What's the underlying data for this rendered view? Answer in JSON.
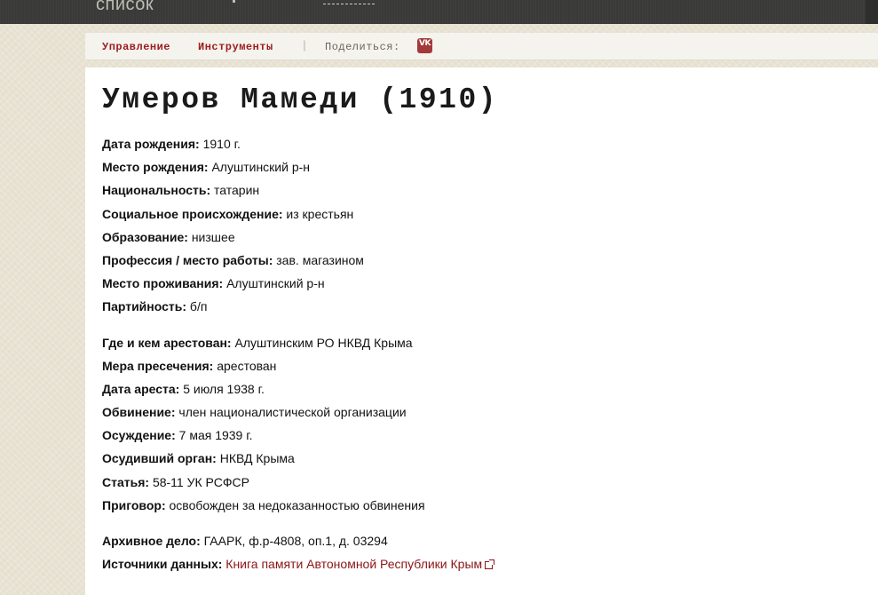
{
  "header": {
    "site_name": "список"
  },
  "toolbar": {
    "manage_label": "Управление",
    "tools_label": "Инструменты",
    "separator": "|",
    "share_label": "Поделиться:",
    "vk_text": "VK"
  },
  "person": {
    "title": "Умеров Мамеди (1910)",
    "group1": [
      {
        "label": "Дата рождения:",
        "value": "1910 г."
      },
      {
        "label": "Место рождения:",
        "value": "Алуштинский р-н"
      },
      {
        "label": "Национальность:",
        "value": "татарин"
      },
      {
        "label": "Социальное происхождение:",
        "value": "из крестьян"
      },
      {
        "label": "Образование:",
        "value": "низшее"
      },
      {
        "label": "Профессия / место работы:",
        "value": "зав. магазином"
      },
      {
        "label": "Место проживания:",
        "value": "Алуштинский р-н"
      },
      {
        "label": "Партийность:",
        "value": "б/п"
      }
    ],
    "group2": [
      {
        "label": "Где и кем арестован:",
        "value": "Алуштинским РО НКВД Крыма"
      },
      {
        "label": "Мера пресечения:",
        "value": "арестован"
      },
      {
        "label": "Дата ареста:",
        "value": "5 июля 1938 г."
      },
      {
        "label": "Обвинение:",
        "value": "член националистической организации"
      },
      {
        "label": "Осуждение:",
        "value": "7 мая 1939 г."
      },
      {
        "label": "Осудивший орган:",
        "value": "НКВД Крыма"
      },
      {
        "label": "Статья:",
        "value": "58-11 УК РСФСР"
      },
      {
        "label": "Приговор:",
        "value": "освобожден за недоказанностью обвинения"
      }
    ],
    "group3": [
      {
        "label": "Архивное дело:",
        "value": "ГААРК, ф.р-4808, оп.1, д. 03294"
      },
      {
        "label": "Источники данных:",
        "value": "Книга памяти Автономной Республики Крым"
      }
    ]
  },
  "colors": {
    "accent": "#9b1c1c",
    "topbar": "#3a3a38",
    "background": "#e9e3d3"
  }
}
